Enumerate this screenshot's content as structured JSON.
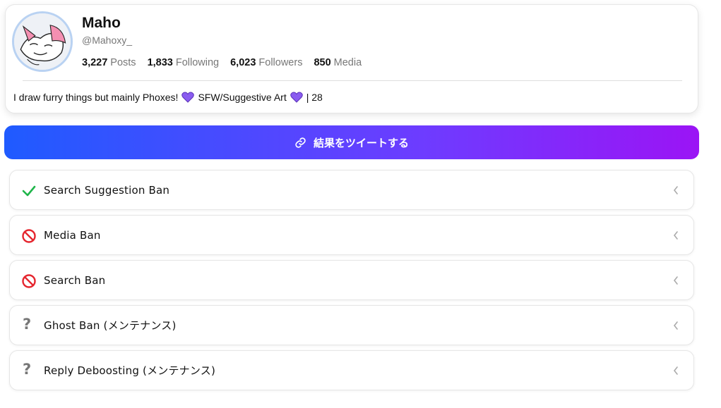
{
  "profile": {
    "display_name": "Maho",
    "handle": "@Mahoxy_",
    "stats": [
      {
        "value": "3,227",
        "label": "Posts"
      },
      {
        "value": "1,833",
        "label": "Following"
      },
      {
        "value": "6,023",
        "label": "Followers"
      },
      {
        "value": "850",
        "label": "Media"
      }
    ],
    "bio": {
      "part1": "I draw furry things but mainly Phoxes!",
      "part2": "SFW/Suggestive Art",
      "part3": "| 28"
    },
    "heart_color": "#8a5cf0"
  },
  "tweet_button": {
    "label": "結果をツイートする",
    "icon": "link-icon"
  },
  "results": [
    {
      "label": "Search Suggestion Ban",
      "status": "ok",
      "icon": "check-icon",
      "color": "#1fb54a"
    },
    {
      "label": "Media Ban",
      "status": "banned",
      "icon": "prohibited-icon",
      "color": "#e5262f"
    },
    {
      "label": "Search Ban",
      "status": "banned",
      "icon": "prohibited-icon",
      "color": "#e5262f"
    },
    {
      "label": "Ghost Ban (メンテナンス)",
      "status": "unknown",
      "icon": "question-icon",
      "color": "#777777"
    },
    {
      "label": "Reply Deboosting (メンテナンス)",
      "status": "unknown",
      "icon": "question-icon",
      "color": "#777777"
    }
  ]
}
